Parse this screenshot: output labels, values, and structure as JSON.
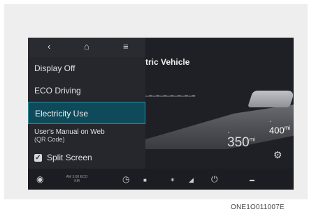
{
  "topbar": {
    "back_icon": "back-chevron-icon",
    "home_icon": "home-icon",
    "menu_icon": "menu-icon"
  },
  "menu": {
    "items": [
      {
        "label": "Display Off"
      },
      {
        "label": "ECO Driving"
      },
      {
        "label": "Electricity Use",
        "selected": true
      },
      {
        "label": "User's Manual on Web",
        "sublabel": "(QR Code)"
      },
      {
        "label": "Split Screen",
        "checked": true
      }
    ]
  },
  "content": {
    "title": "tric Vehicle",
    "range_top": "400",
    "range_top_unit": "mi",
    "range_main": "350",
    "range_main_unit": "mi"
  },
  "bottombar": {
    "left_text": "AM 3:00 ECO KM"
  },
  "caption": "ONE1O011007E",
  "colors": {
    "screen_bg": "#2a2b31",
    "selected_bg": "#0f4a5a",
    "selected_border": "#2f8c9e"
  }
}
